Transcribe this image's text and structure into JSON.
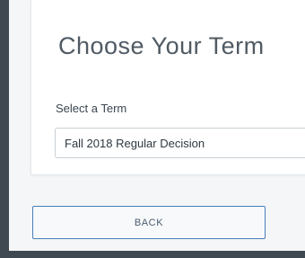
{
  "term_card": {
    "heading": "Choose Your Term",
    "select_label": "Select a Term",
    "selected_term": "Fall 2018 Regular Decision"
  },
  "actions": {
    "back_label": "BACK"
  },
  "colors": {
    "outer_frame": "#3f4952",
    "page_background": "#f4f6f7",
    "card_background": "#ffffff",
    "button_border": "#4a7fb8"
  }
}
